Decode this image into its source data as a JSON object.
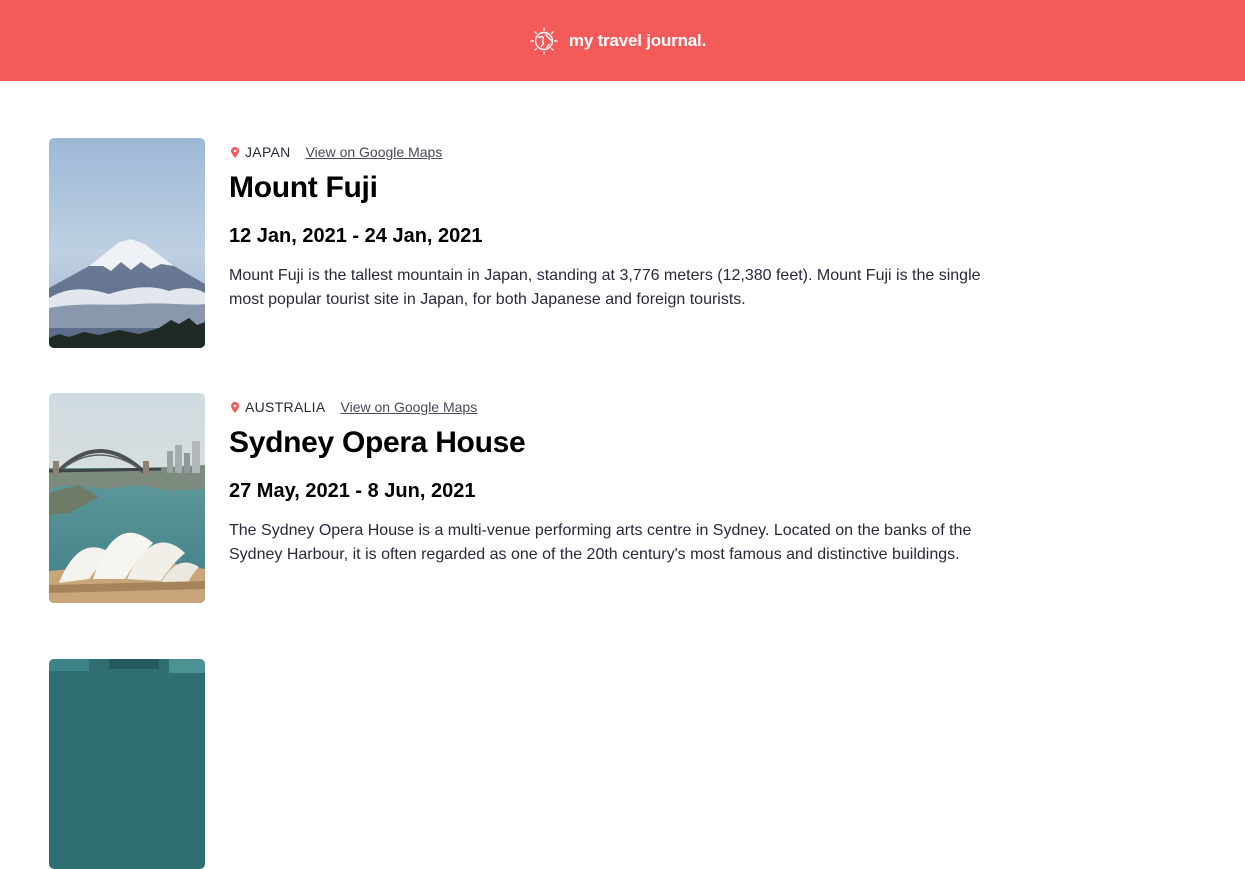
{
  "header": {
    "title": "my travel journal.",
    "icon": "globe-icon",
    "background": "#F55A5A"
  },
  "entries": [
    {
      "country": "JAPAN",
      "maps_label": "View on Google Maps",
      "title": "Mount Fuji",
      "dates": "12 Jan, 2021 - 24 Jan, 2021",
      "description": "Mount Fuji is the tallest mountain in Japan, standing at 3,776 meters (12,380 feet). Mount Fuji is the single most popular tourist site in Japan, for both Japanese and foreign tourists."
    },
    {
      "country": "AUSTRALIA",
      "maps_label": "View on Google Maps",
      "title": "Sydney Opera House",
      "dates": "27 May, 2021 - 8 Jun, 2021",
      "description": "The Sydney Opera House is a multi-venue performing arts centre in Sydney. Located on the banks of the Sydney Harbour, it is often regarded as one of the 20th century's most famous and distinctive buildings."
    }
  ],
  "colors": {
    "accent": "#F55A5A",
    "pin": "#F55A5A",
    "text": "#2B283A"
  }
}
